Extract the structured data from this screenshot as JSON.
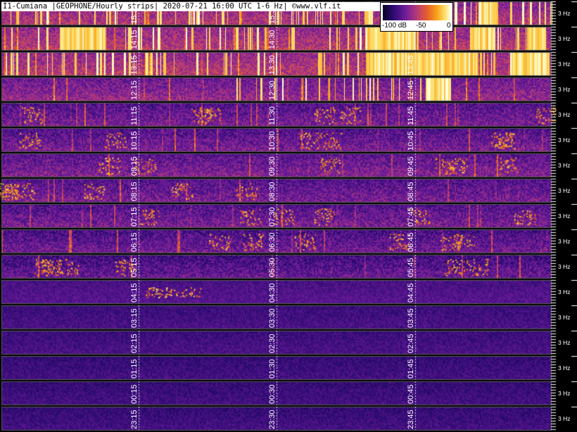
{
  "header": {
    "title": "I1-Cumiana |GEOPHONE/Hourly strips| 2020-07-21 16:00 UTC 1-6 Hz| ©www.vlf.it"
  },
  "colorbar": {
    "min_label": "-100 dB",
    "mid_label": "-50",
    "max_label": "0"
  },
  "rows": [
    {
      "labels": [
        "15:15",
        "15:30",
        "",
        ""
      ],
      "intensity": 0.85,
      "band": "high"
    },
    {
      "labels": [
        "14:15",
        "14:30",
        "",
        ""
      ],
      "intensity": 0.9,
      "band": "high"
    },
    {
      "labels": [
        "13:15",
        "13:30",
        "13:45",
        ""
      ],
      "intensity": 0.9,
      "band": "high"
    },
    {
      "labels": [
        "12:15",
        "12:30",
        "12:45",
        ""
      ],
      "intensity": 0.7,
      "band": "mid"
    },
    {
      "labels": [
        "11:15",
        "11:30",
        "11:45",
        ""
      ],
      "intensity": 0.55,
      "band": "mid"
    },
    {
      "labels": [
        "10:15",
        "10:30",
        "10:45",
        ""
      ],
      "intensity": 0.55,
      "band": "mid"
    },
    {
      "labels": [
        "09:15",
        "09:30",
        "09:45",
        ""
      ],
      "intensity": 0.6,
      "band": "mid"
    },
    {
      "labels": [
        "08:15",
        "08:30",
        "08:45",
        ""
      ],
      "intensity": 0.55,
      "band": "mid"
    },
    {
      "labels": [
        "07:15",
        "07:30",
        "07:45",
        ""
      ],
      "intensity": 0.55,
      "band": "mid"
    },
    {
      "labels": [
        "06:15",
        "06:30",
        "06:45",
        ""
      ],
      "intensity": 0.5,
      "band": "mid"
    },
    {
      "labels": [
        "05:15",
        "05:30",
        "05:45",
        ""
      ],
      "intensity": 0.45,
      "band": "mid"
    },
    {
      "labels": [
        "04:15",
        "04:30",
        "04:45",
        ""
      ],
      "intensity": 0.3,
      "band": "low"
    },
    {
      "labels": [
        "03:15",
        "03:30",
        "03:45",
        ""
      ],
      "intensity": 0.2,
      "band": "low"
    },
    {
      "labels": [
        "02:15",
        "02:30",
        "02:45",
        ""
      ],
      "intensity": 0.2,
      "band": "low"
    },
    {
      "labels": [
        "01:15",
        "01:30",
        "01:45",
        ""
      ],
      "intensity": 0.15,
      "band": "low"
    },
    {
      "labels": [
        "00:15",
        "00:30",
        "00:45",
        ""
      ],
      "intensity": 0.15,
      "band": "low"
    },
    {
      "labels": [
        "23:15",
        "23:30",
        "23:45",
        ""
      ],
      "intensity": 0.15,
      "band": "low"
    }
  ],
  "hz_label": "3 Hz"
}
